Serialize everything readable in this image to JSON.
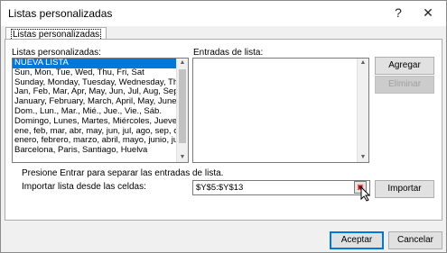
{
  "window": {
    "title": "Listas personalizadas",
    "help_label": "?",
    "close_label": "✕"
  },
  "tabs": [
    "Listas personalizadas"
  ],
  "custom_lists": {
    "label": "Listas personalizadas:",
    "items": [
      "NUEVA LISTA",
      "Sun, Mon, Tue, Wed, Thu, Fri, Sat",
      "Sunday, Monday, Tuesday, Wednesday, Thursd",
      "Jan, Feb, Mar, Apr, May, Jun, Jul, Aug, Sep, Oct,",
      "January, February, March, April, May, June, July,",
      "Dom., Lun., Mar., Mié., Jue., Vie., Sáb.",
      "Domingo, Lunes, Martes, Miércoles, Jueves, Vie",
      "ene, feb, mar, abr, may, jun, jul, ago, sep, oct, n",
      "enero, febrero, marzo, abril, mayo, junio, julio,",
      "Barcelona, Paris, Santiago, Huelva"
    ],
    "selected_index": 0
  },
  "entries": {
    "label": "Entradas de lista:"
  },
  "buttons": {
    "add": "Agregar",
    "delete": "Eliminar",
    "import": "Importar",
    "accept": "Aceptar",
    "cancel": "Cancelar"
  },
  "hint": "Presione Entrar para separar las entradas de lista.",
  "import_from": {
    "label": "Importar lista desde las celdas:",
    "value": "$Y$5:$Y$13"
  },
  "colors": {
    "selection": "#0078d7",
    "dialog_bg": "#f0f0f0"
  }
}
